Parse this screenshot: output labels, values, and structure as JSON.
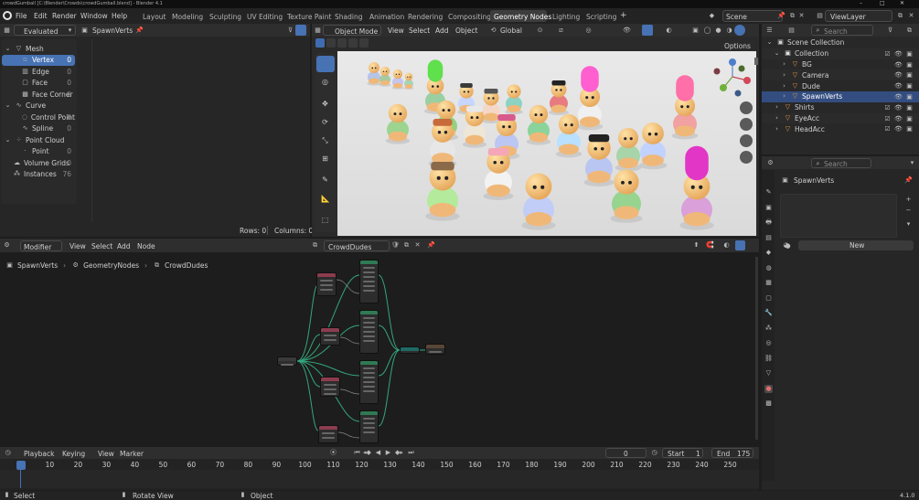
{
  "window": {
    "title": "crowdGumball [C:\\Blender\\Crowds\\crowdGumball.blend] - Blender 4.1",
    "controls": [
      "–",
      "□",
      "✕"
    ]
  },
  "topbar": {
    "menus": [
      "File",
      "Edit",
      "Render",
      "Window",
      "Help"
    ],
    "workspaces": [
      "Layout",
      "Modeling",
      "Sculpting",
      "UV Editing",
      "Texture Paint",
      "Shading",
      "Animation",
      "Rendering",
      "Compositing",
      "Geometry Nodes",
      "Lighting",
      "Scripting"
    ],
    "active_workspace": "Geometry Nodes",
    "add_tab": "+",
    "scene": "Scene",
    "view_layer": "ViewLayer"
  },
  "spreadsheet": {
    "mode": "Evaluated",
    "object": "SpawnVerts",
    "tree": [
      {
        "label": "Mesh",
        "count": "",
        "level": 0,
        "icon": "mesh-icon",
        "active": false
      },
      {
        "label": "Vertex",
        "count": "0",
        "level": 1,
        "icon": "vertex-icon",
        "active": true
      },
      {
        "label": "Edge",
        "count": "0",
        "level": 1,
        "icon": "edge-icon",
        "active": false
      },
      {
        "label": "Face",
        "count": "0",
        "level": 1,
        "icon": "face-icon",
        "active": false
      },
      {
        "label": "Face Corner",
        "count": "0",
        "level": 1,
        "icon": "face-corner-icon",
        "active": false
      },
      {
        "label": "Curve",
        "count": "",
        "level": 0,
        "icon": "curve-icon",
        "active": false
      },
      {
        "label": "Control Point",
        "count": "0",
        "level": 1,
        "icon": "control-point-icon",
        "active": false
      },
      {
        "label": "Spline",
        "count": "0",
        "level": 1,
        "icon": "spline-icon",
        "active": false
      },
      {
        "label": "Point Cloud",
        "count": "",
        "level": 0,
        "icon": "point-cloud-icon",
        "active": false
      },
      {
        "label": "Point",
        "count": "0",
        "level": 1,
        "icon": "point-icon",
        "active": false
      },
      {
        "label": "Volume Grids",
        "count": "0",
        "level": 0,
        "icon": "volume-icon",
        "active": false
      },
      {
        "label": "Instances",
        "count": "76",
        "level": 0,
        "icon": "instances-icon",
        "active": false
      }
    ],
    "rows": "Rows: 0",
    "columns": "Columns: 0"
  },
  "viewport": {
    "mode": "Object Mode",
    "menus": [
      "View",
      "Select",
      "Add",
      "Object"
    ],
    "orientation": "Global",
    "options": "Options"
  },
  "node_editor": {
    "editor": "Modifier",
    "menus": [
      "View",
      "Select",
      "Add",
      "Node"
    ],
    "tree_name": "CrowdDudes",
    "breadcrumb": [
      "SpawnVerts",
      "GeometryNodes",
      "CrowdDudes"
    ]
  },
  "outliner": {
    "search_placeholder": "Search",
    "items": [
      {
        "label": "Scene Collection",
        "level": 0,
        "icon": "scene-collection-icon",
        "selected": false
      },
      {
        "label": "Collection",
        "level": 1,
        "icon": "collection-icon",
        "selected": false
      },
      {
        "label": "BG",
        "level": 2,
        "icon": "object-icon",
        "selected": false
      },
      {
        "label": "Camera",
        "level": 2,
        "icon": "object-icon",
        "selected": false
      },
      {
        "label": "Dude",
        "level": 2,
        "icon": "object-icon",
        "selected": false
      },
      {
        "label": "SpawnVerts",
        "level": 2,
        "icon": "object-icon",
        "selected": true
      },
      {
        "label": "Shirts",
        "level": 1,
        "icon": "object-icon",
        "selected": false
      },
      {
        "label": "EyeAcc",
        "level": 1,
        "icon": "object-icon",
        "selected": false
      },
      {
        "label": "HeadAcc",
        "level": 1,
        "icon": "object-icon",
        "selected": false
      }
    ]
  },
  "properties": {
    "search_placeholder": "Search",
    "object": "SpawnVerts",
    "new_label": "New"
  },
  "timeline": {
    "menus": [
      "Playback",
      "Keying",
      "View",
      "Marker"
    ],
    "current_frame": "0",
    "start_label": "Start",
    "start": "1",
    "end_label": "End",
    "end": "175",
    "ticks": [
      "0",
      "10",
      "20",
      "30",
      "40",
      "50",
      "60",
      "70",
      "80",
      "90",
      "100",
      "110",
      "120",
      "130",
      "140",
      "150",
      "160",
      "170",
      "180",
      "190",
      "200",
      "210",
      "220",
      "230",
      "240",
      "250"
    ]
  },
  "statusbar": {
    "items": [
      "Select",
      "Rotate View",
      "Object"
    ],
    "version": "4.1.0"
  },
  "colors": {
    "accent": "#4772b3",
    "active_tab": "#3d3d3d",
    "node_green": "#2f7a55",
    "node_red": "#8c3c4e",
    "node_teal": "#1f6a66"
  }
}
